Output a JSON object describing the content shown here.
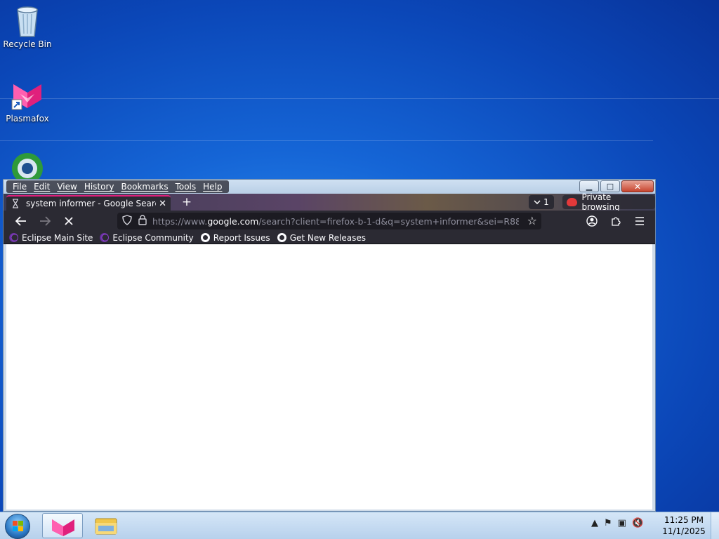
{
  "desktop": {
    "icons": [
      {
        "label": "Recycle Bin",
        "icon": "recycle-bin-icon"
      },
      {
        "label": "Plasmafox",
        "icon": "plasmafox-icon"
      },
      {
        "label": "",
        "icon": "browser-globe-icon"
      }
    ]
  },
  "browser": {
    "menu": [
      "File",
      "Edit",
      "View",
      "History",
      "Bookmarks",
      "Tools",
      "Help"
    ],
    "tab": {
      "title": "system informer - Google Searc",
      "close": "✕"
    },
    "new_tab": "+",
    "tab_count": "1",
    "private_label": "Private browsing",
    "url": {
      "prefix": "https://www.",
      "host": "google.com",
      "rest": "/search?client=firefox-b-1-d&q=system+informer&sei=R88"
    },
    "bookmarks": [
      {
        "label": "Eclipse Main Site",
        "icon": "eclipse-icon"
      },
      {
        "label": "Eclipse Community",
        "icon": "eclipse-icon"
      },
      {
        "label": "Report Issues",
        "icon": "github-icon"
      },
      {
        "label": "Get New Releases",
        "icon": "github-icon"
      }
    ]
  },
  "taskbar": {
    "time": "11:25 PM",
    "date": "11/1/2025"
  },
  "colors": {
    "accent_tab": "#e0207c",
    "toolbar": "#2b2a33",
    "urlbar": "#1c1b22"
  }
}
